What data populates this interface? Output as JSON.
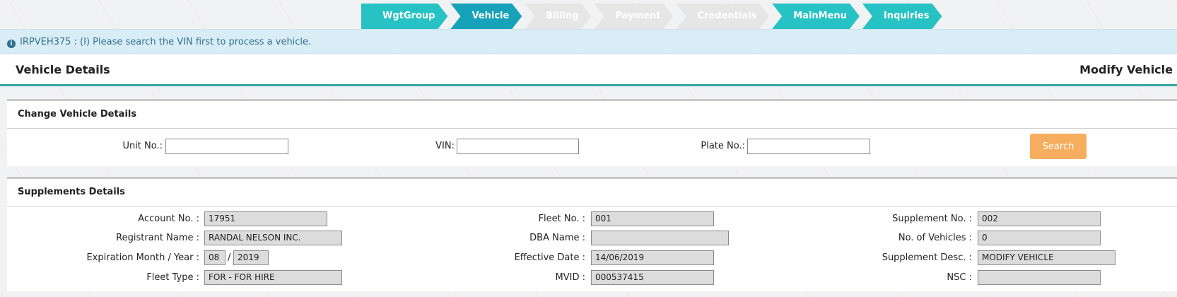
{
  "wizard": {
    "steps": [
      {
        "label": "WgtGroup",
        "state": "done"
      },
      {
        "label": "Vehicle",
        "state": "active"
      },
      {
        "label": "Billing",
        "state": "disabled"
      },
      {
        "label": "Payment",
        "state": "disabled"
      },
      {
        "label": "Credentials",
        "state": "disabled"
      },
      {
        "label": "MainMenu",
        "state": "done"
      },
      {
        "label": "Inquiries",
        "state": "done"
      }
    ],
    "colors": {
      "done": "#27c2c3",
      "active": "#16a2b8",
      "disabled": "#e6e6e6",
      "disabled_text": "#ffffff"
    }
  },
  "banner": {
    "icon": "info-icon",
    "message": "IRPVEH375 : (I) Please search the VIN first to process a vehicle."
  },
  "header": {
    "title": "Vehicle Details",
    "action": "Modify Vehicle"
  },
  "change_panel": {
    "title": "Change Vehicle Details",
    "unit_label": "Unit No.:",
    "unit_value": "",
    "vin_label": "VIN:",
    "vin_value": "",
    "plate_label": "Plate No.:",
    "plate_value": "",
    "search_label": "Search"
  },
  "supp_panel": {
    "title": "Supplements Details",
    "account_label": "Account No. :",
    "account_value": "17951",
    "registrant_label": "Registrant Name :",
    "registrant_value": "RANDAL NELSON INC.",
    "expiration_label": "Expiration Month / Year :",
    "exp_month": "08",
    "exp_sep": "/",
    "exp_year": "2019",
    "fleet_type_label": "Fleet Type :",
    "fleet_type_value": "FOR - FOR HIRE",
    "fleet_no_label": "Fleet No. :",
    "fleet_no_value": "001",
    "dba_label": "DBA Name :",
    "dba_value": "",
    "effective_label": "Effective Date :",
    "effective_value": "14/06/2019",
    "mvid_label": "MVID :",
    "mvid_value": "000537415",
    "supp_no_label": "Supplement No. :",
    "supp_no_value": "002",
    "vehicles_label": "No. of Vehicles :",
    "vehicles_value": "0",
    "supp_desc_label": "Supplement Desc. :",
    "supp_desc_value": "MODIFY VEHICLE",
    "nsc_label": "NSC :",
    "nsc_value": ""
  }
}
